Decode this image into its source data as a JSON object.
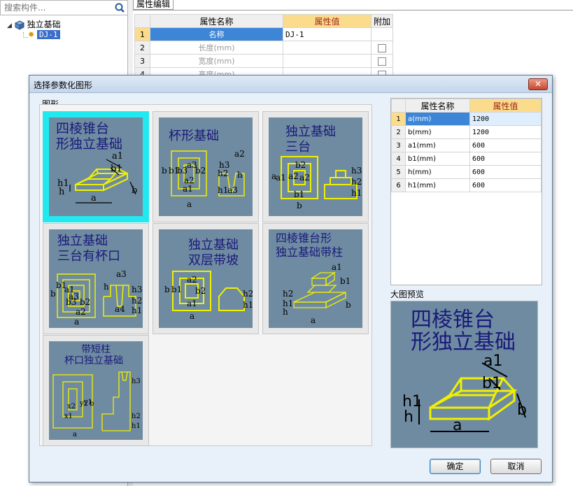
{
  "search": {
    "placeholder": "搜索构件..."
  },
  "tree": {
    "root_label": "独立基础",
    "child_label": "DJ-1"
  },
  "property_editor": {
    "tab_label": "属性编辑",
    "headers": {
      "name": "属性名称",
      "value": "属性值",
      "extra": "附加"
    },
    "rows": [
      {
        "num": "1",
        "name": "名称",
        "value": "DJ-1",
        "extra": false
      },
      {
        "num": "2",
        "name": "长度(mm)",
        "value": "",
        "extra": true
      },
      {
        "num": "3",
        "name": "宽度(mm)",
        "value": "",
        "extra": true
      },
      {
        "num": "4",
        "name": "高度(mm)",
        "value": "",
        "extra": true
      }
    ]
  },
  "dialog": {
    "title": "选择参数化图形",
    "close_label": "✕",
    "gallery_label": "图形",
    "thumbnails": [
      {
        "title_line1": "四棱锥台",
        "title_line2": "形独立基础"
      },
      {
        "title_line1": "杯形基础",
        "title_line2": ""
      },
      {
        "title_line1": "独立基础",
        "title_line2": "三台"
      },
      {
        "title_line1": "独立基础",
        "title_line2": "三台有杯口"
      },
      {
        "title_line1": "独立基础",
        "title_line2": "双层带坡"
      },
      {
        "title_line1": "四棱锥台形",
        "title_line2": "独立基础带柱"
      },
      {
        "title_line1": "带短柱",
        "title_line2": "杯口独立基础"
      }
    ],
    "params_table": {
      "headers": {
        "name": "属性名称",
        "value": "属性值"
      },
      "rows": [
        {
          "num": "1",
          "name": "a(mm)",
          "value": "1200"
        },
        {
          "num": "2",
          "name": "b(mm)",
          "value": "1200"
        },
        {
          "num": "3",
          "name": "a1(mm)",
          "value": "600"
        },
        {
          "num": "4",
          "name": "b1(mm)",
          "value": "600"
        },
        {
          "num": "5",
          "name": "h(mm)",
          "value": "600"
        },
        {
          "num": "6",
          "name": "h1(mm)",
          "value": "600"
        }
      ]
    },
    "preview_label": "大图预览",
    "preview": {
      "title_line1": "四棱锥台",
      "title_line2": "形独立基础"
    },
    "ok_label": "确定",
    "cancel_label": "取消"
  },
  "colors": {
    "thumbnail_bg": "#6f8ba1",
    "drawing_line": "#f0f000",
    "drawing_title": "#1a1a7a",
    "selection": "#22e8f0",
    "value_header": "#fadc8c",
    "selected_row": "#3d85d6"
  }
}
